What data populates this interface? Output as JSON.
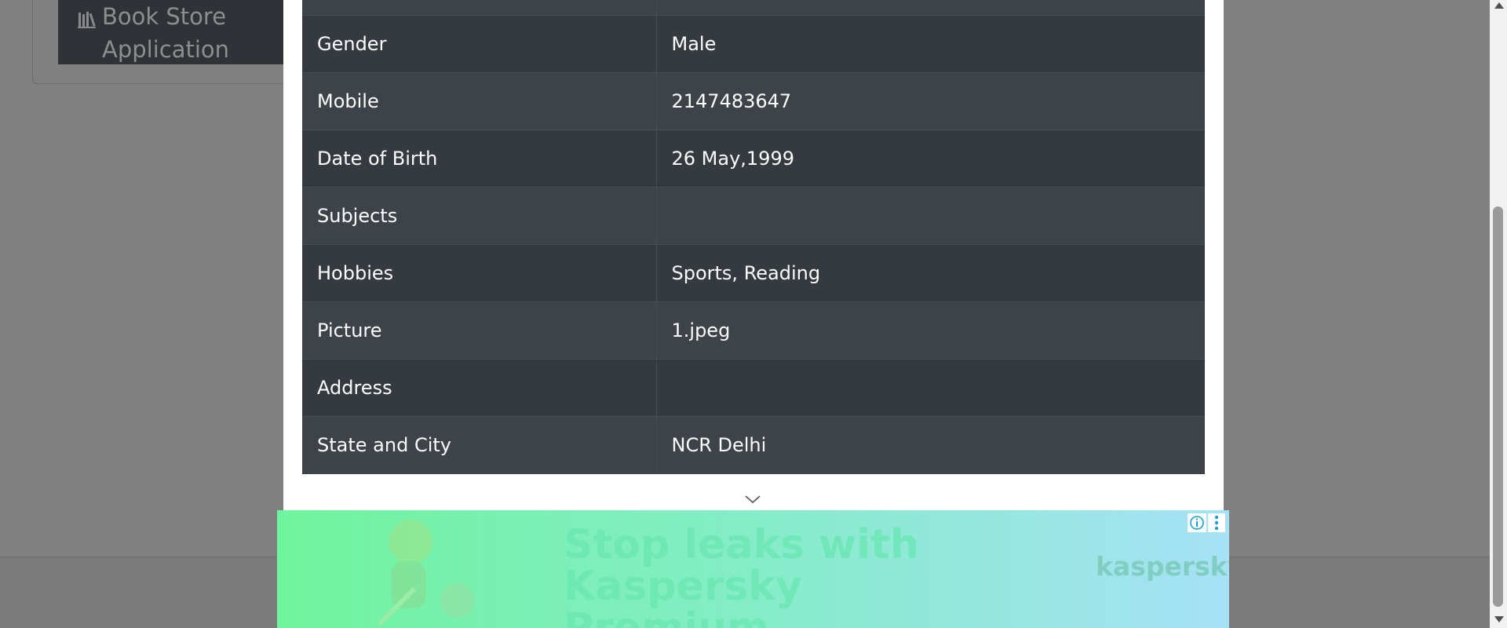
{
  "sidebar": {
    "item_label": "Book Store Application",
    "item_icon": "books-icon"
  },
  "modal": {
    "rows": [
      {
        "label": "",
        "value": ""
      },
      {
        "label": "Gender",
        "value": "Male"
      },
      {
        "label": "Mobile",
        "value": "2147483647"
      },
      {
        "label": "Date of Birth",
        "value": "26 May,1999"
      },
      {
        "label": "Subjects",
        "value": ""
      },
      {
        "label": "Hobbies",
        "value": "Sports, Reading"
      },
      {
        "label": "Picture",
        "value": "1.jpeg"
      },
      {
        "label": "Address",
        "value": ""
      },
      {
        "label": "State and City",
        "value": "NCR Delhi"
      }
    ],
    "collapse_icon": "chevron-down-icon"
  },
  "ad": {
    "headline": "Stop leaks with Kaspersky Premium",
    "brand": "kaspersky",
    "info_icon": "info-icon",
    "menu_icon": "kebab-menu-icon"
  },
  "colors": {
    "table_odd": "#3e434a",
    "table_even": "#343a40",
    "overlay": "#808080"
  }
}
